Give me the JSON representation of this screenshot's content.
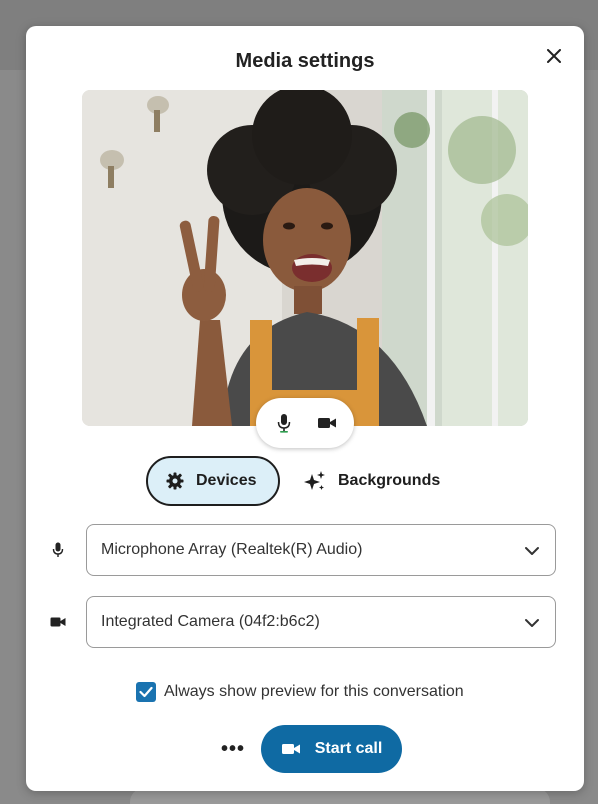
{
  "dialog": {
    "title": "Media settings",
    "close_icon": "close-icon"
  },
  "preview": {
    "mic_icon": "microphone-icon",
    "camera_icon": "video-camera-icon"
  },
  "tabs": [
    {
      "label": "Devices",
      "icon": "gear-icon",
      "selected": true
    },
    {
      "label": "Backgrounds",
      "icon": "sparkle-icon",
      "selected": false
    }
  ],
  "devices": {
    "microphone": {
      "icon": "microphone-icon",
      "value": "Microphone Array (Realtek(R) Audio)"
    },
    "camera": {
      "icon": "video-camera-icon",
      "value": "Integrated Camera (04f2:b6c2)"
    }
  },
  "preview_option": {
    "label": "Always show preview for this conversation",
    "checked": true
  },
  "actions": {
    "more_label": "•••",
    "start_call_label": "Start call"
  },
  "colors": {
    "accent": "#0f6aa3",
    "checkbox": "#1a73b0",
    "selected_tab_bg": "#dceff8",
    "mic_active": "#2e9e4f"
  }
}
